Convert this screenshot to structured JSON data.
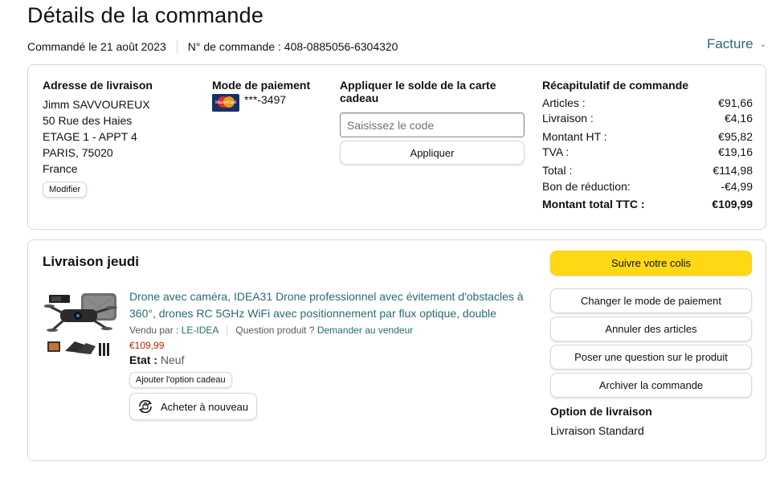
{
  "header": {
    "title": "Détails de la commande",
    "ordered_on": "Commandé le 21 août 2023",
    "order_number": "N° de commande : 408-0885056-6304320",
    "invoice_label": "Facture"
  },
  "address": {
    "title": "Adresse de livraison",
    "lines": [
      "Jimm SAVVOUREUX",
      "50 Rue des Haies",
      "ETAGE 1 - APPT 4",
      "PARIS, 75020",
      "France"
    ],
    "edit_label": "Modifier"
  },
  "payment": {
    "title": "Mode de paiement",
    "card_brand_icon": "mastercard-icon",
    "card_text": "MasterCard",
    "card_number": "***-3497"
  },
  "gift_card": {
    "title": "Appliquer le solde de la carte cadeau",
    "placeholder": "Saisissez le code",
    "apply_label": "Appliquer"
  },
  "summary": {
    "title": "Récapitulatif de commande",
    "rows": [
      {
        "label": "Articles :",
        "value": "€91,66"
      },
      {
        "label": "Livraison :",
        "value": "€4,16"
      },
      {
        "label": "Montant HT :",
        "value": "€95,82"
      },
      {
        "label": "TVA :",
        "value": "€19,16"
      },
      {
        "label": "Total :",
        "value": "€114,98"
      },
      {
        "label": "Bon de réduction:",
        "value": "-€4,99"
      }
    ],
    "grand_total": {
      "label": "Montant total TTC :",
      "value": "€109,99"
    }
  },
  "delivery": {
    "title": "Livraison jeudi",
    "product": {
      "title": "Drone avec caméra, IDEA31 Drone professionnel avec évitement d'obstacles à 360°, drones RC 5GHz WiFi avec positionnement par flux optique, double",
      "seller_prefix": "Vendu par :",
      "seller_name": "LE-IDEA",
      "question_prefix": "Question produit ?",
      "question_link": "Demander au vendeur",
      "price": "€109,99",
      "condition_label": "Etat :",
      "condition_value": "Neuf",
      "gift_option_label": "Ajouter l'option cadeau",
      "rebuy_label": "Acheter à nouveau"
    },
    "actions": {
      "track": "Suivre votre colis",
      "change_payment": "Changer le mode de paiement",
      "cancel": "Annuler des articles",
      "question": "Poser une question sur le produit",
      "archive": "Archiver la commande"
    },
    "option_title": "Option de livraison",
    "option_value": "Livraison Standard"
  },
  "colors": {
    "link": "#2a6a73",
    "price": "#b12704",
    "primary_button": "#ffd814",
    "border": "#d5d9d9"
  }
}
